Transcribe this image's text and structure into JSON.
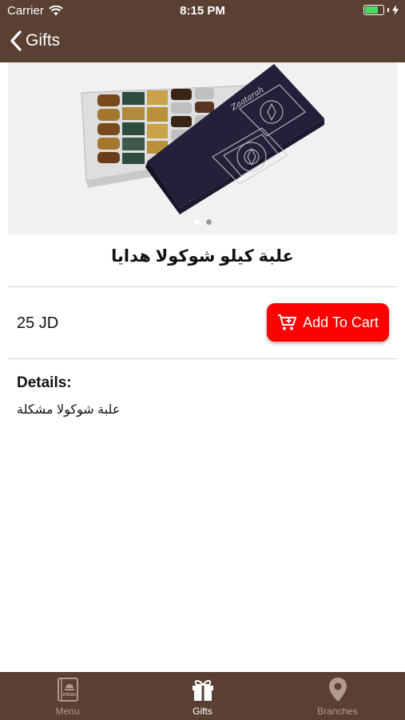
{
  "status_bar": {
    "carrier": "Carrier",
    "time": "8:15 PM",
    "battery_level": 0.8,
    "battery_color": "#4cd964"
  },
  "nav": {
    "back_label": "Gifts"
  },
  "carousel": {
    "image_alt": "Gift chocolate box",
    "page_count": 2,
    "current_page": 1
  },
  "product": {
    "title": "علبة كيلو شوكولا هدايا",
    "price": "25 JD",
    "add_to_cart_label": "Add To Cart",
    "details_heading": "Details:",
    "details_text": "علبة شوكولا مشكلة"
  },
  "tab_bar": {
    "items": [
      {
        "label": "Menu",
        "icon": "menu-book-icon",
        "active": false
      },
      {
        "label": "Gifts",
        "icon": "gift-icon",
        "active": true
      },
      {
        "label": "Branches",
        "icon": "location-pin-icon",
        "active": false
      }
    ]
  },
  "colors": {
    "brand_brown": "#5a3f33",
    "cart_red": "#fe0000",
    "tab_inactive": "#b09a8d"
  }
}
